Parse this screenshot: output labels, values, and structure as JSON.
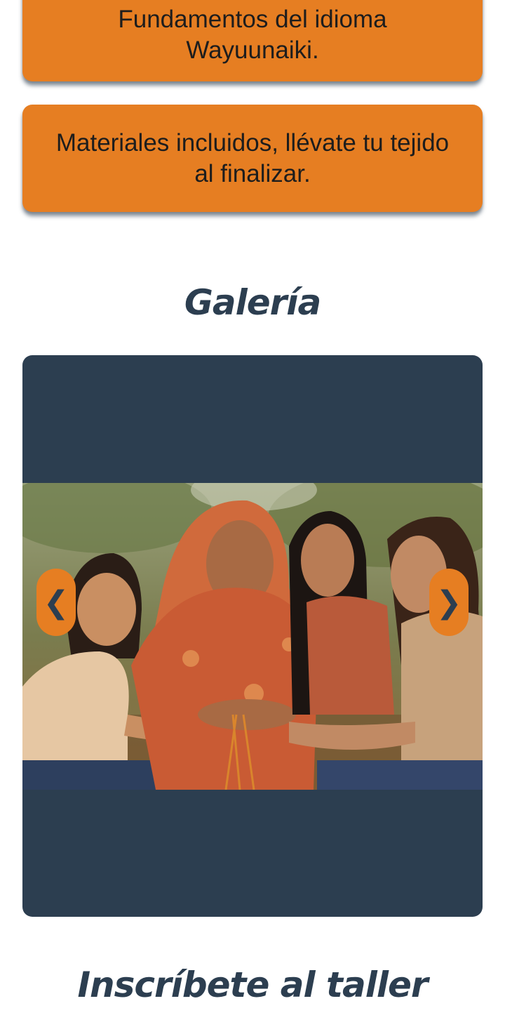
{
  "features": {
    "language_label": "Fundamentos del idioma Wayuunaiki.",
    "materials_label": "Materiales incluidos, llévate tu tejido al finalizar."
  },
  "gallery": {
    "title": "Galería",
    "prev_label": "❮",
    "next_label": "❯"
  },
  "signup": {
    "title": "Inscríbete al taller"
  },
  "colors": {
    "accent": "#e67e22",
    "dark": "#2c3e50",
    "background": "#ffffff"
  }
}
